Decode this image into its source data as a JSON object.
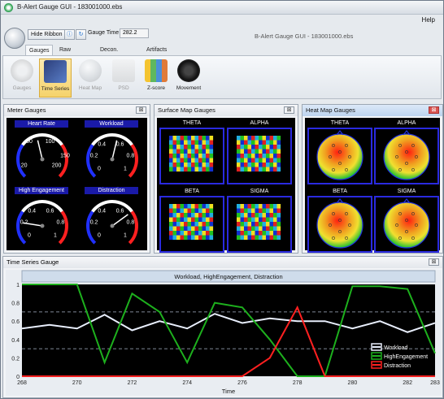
{
  "window": {
    "title": "B-Alert Gauge GUI  -  183001000.ebs",
    "minimize": "–",
    "maximize": "□",
    "close": "✕"
  },
  "menu": {
    "help": "Help"
  },
  "toolbar": {
    "hide_ribbon": "Hide Ribbon",
    "gauge_time_label": "Gauge Time",
    "gauge_time_value": "282.2",
    "center_title": "B-Alert Gauge GUI - 183001000.ebs"
  },
  "tabs": [
    {
      "label": "Gauges",
      "active": true
    },
    {
      "label": "Raw Signals",
      "active": false
    },
    {
      "label": "Decon. Signals",
      "active": false
    },
    {
      "label": "Artifacts",
      "active": false
    }
  ],
  "ribbon": [
    {
      "label": "Gauges",
      "icon": "gauge-icon",
      "disabled": true
    },
    {
      "label": "Time Series",
      "icon": "time-series-icon",
      "selected": true
    },
    {
      "label": "Heat Map",
      "icon": "heat-map-icon",
      "disabled": true
    },
    {
      "label": "PSD",
      "icon": "psd-icon",
      "disabled": true
    },
    {
      "label": "Z-score",
      "icon": "z-score-icon"
    },
    {
      "label": "Movement",
      "icon": "movement-icon"
    }
  ],
  "meter_panel": {
    "title": "Meter Gauges",
    "close": "⊠",
    "gauges": [
      {
        "label": "Heart Rate",
        "ticks": [
          "50",
          "100",
          "150",
          "20",
          "200"
        ],
        "value": 0.45
      },
      {
        "label": "Workload",
        "ticks": [
          "0.4",
          "0.6",
          "0.2",
          "0.8",
          "0",
          "1"
        ],
        "value": 0.55
      },
      {
        "label": "High Engagement",
        "ticks": [
          "0.4",
          "0.6",
          "0.2",
          "0.8",
          "0",
          "1"
        ],
        "value": 0.2
      },
      {
        "label": "Distraction",
        "ticks": [
          "0.4",
          "0.6",
          "0.2",
          "0.8",
          "0",
          "1"
        ],
        "value": 0.7
      }
    ]
  },
  "surface_panel": {
    "title": "Surface Map Gauges",
    "close": "⊠",
    "maps": [
      "THETA",
      "ALPHA",
      "BETA",
      "SIGMA"
    ]
  },
  "heat_panel": {
    "title": "Heat Map Gauges",
    "close": "⊠",
    "maps": [
      "THETA",
      "ALPHA",
      "BETA",
      "SIGMA"
    ]
  },
  "timeseries_panel": {
    "title": "Time Series Gauge",
    "close": "⊠"
  },
  "chart_data": {
    "type": "line",
    "title": "Workload, HighEngagement, Distraction",
    "xlabel": "Time",
    "ylabel": "",
    "xlim": [
      268,
      283
    ],
    "ylim": [
      0,
      1
    ],
    "x_ticks": [
      "268",
      "270",
      "272",
      "274",
      "276",
      "278",
      "280",
      "282",
      "283"
    ],
    "y_ticks": [
      "0",
      "0.2",
      "0.4",
      "0.6",
      "0.8",
      "1"
    ],
    "threshold_lines": [
      0.7,
      0.3
    ],
    "legend_position": "bottom-right",
    "x": [
      268,
      269,
      270,
      271,
      272,
      273,
      274,
      275,
      276,
      277,
      278,
      279,
      280,
      281,
      282,
      283
    ],
    "series": [
      {
        "name": "Workload",
        "color": "#e8eefc",
        "values": [
          0.52,
          0.56,
          0.52,
          0.67,
          0.5,
          0.6,
          0.52,
          0.68,
          0.58,
          0.63,
          0.6,
          0.6,
          0.52,
          0.6,
          0.48,
          0.58
        ]
      },
      {
        "name": "HighEngagement",
        "color": "#1db01d",
        "values": [
          1.0,
          1.0,
          1.0,
          0.15,
          0.9,
          0.7,
          0.15,
          0.8,
          0.75,
          0.4,
          0.0,
          0.0,
          0.98,
          0.98,
          0.95,
          0.25
        ]
      },
      {
        "name": "Distraction",
        "color": "#ff2020",
        "values": [
          0.0,
          0.0,
          0.0,
          0.0,
          0.0,
          0.0,
          0.0,
          0.0,
          0.0,
          0.2,
          0.75,
          0.0,
          0.0,
          0.0,
          0.0,
          0.0
        ]
      }
    ]
  }
}
